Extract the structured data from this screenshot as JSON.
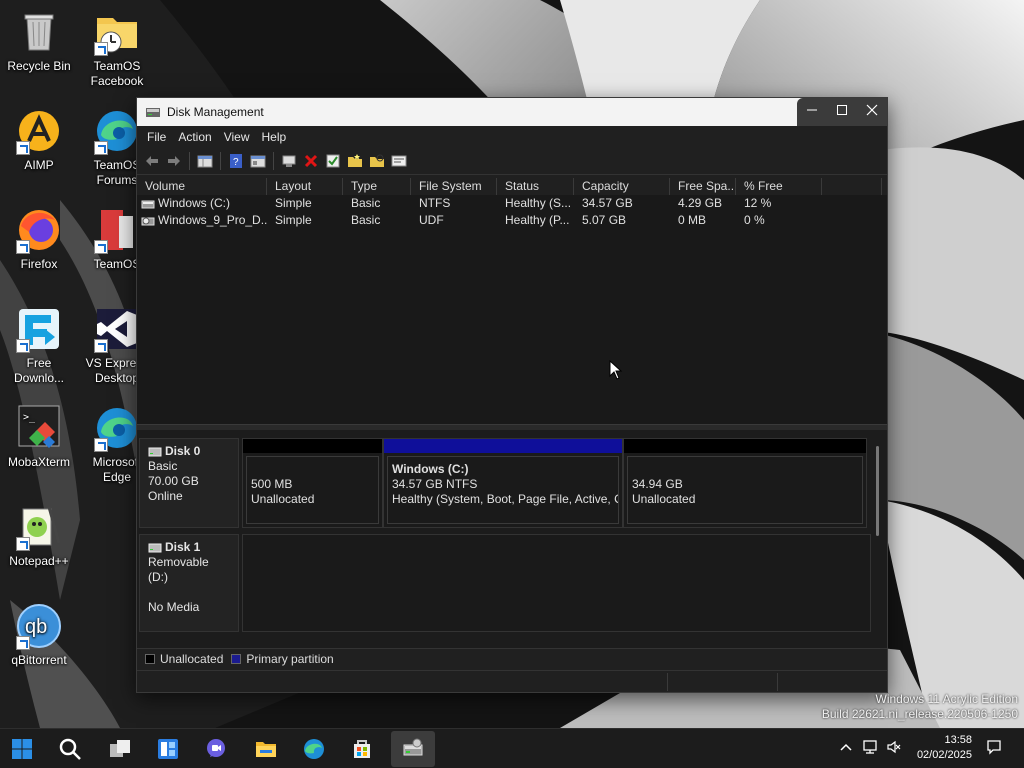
{
  "desktop": {
    "icons": [
      {
        "label": "Recycle Bin"
      },
      {
        "label": "TeamOS Facebook"
      },
      {
        "label": "AIMP"
      },
      {
        "label": "TeamOS Forums"
      },
      {
        "label": "Firefox"
      },
      {
        "label": "TeamOS"
      },
      {
        "label": "Free Downlo..."
      },
      {
        "label": "VS Express Desktop"
      },
      {
        "label": "MobaXterm"
      },
      {
        "label": "Microsoft Edge"
      },
      {
        "label": "Notepad++"
      },
      {
        "label": "qBittorrent"
      }
    ]
  },
  "window": {
    "title": "Disk Management",
    "menu": [
      "File",
      "Action",
      "View",
      "Help"
    ],
    "toolbar_icons": [
      "back-icon",
      "forward-icon",
      "console-tree-icon",
      "help-icon",
      "properties-icon",
      "connect-icon",
      "delete-icon",
      "check-icon",
      "new-folder-icon",
      "folder-search-icon",
      "settings-list-icon"
    ]
  },
  "volume_list": {
    "columns": [
      "Volume",
      "Layout",
      "Type",
      "File System",
      "Status",
      "Capacity",
      "Free Spa...",
      "% Free",
      ""
    ],
    "rows": [
      [
        "Windows (C:)",
        "Simple",
        "Basic",
        "NTFS",
        "Healthy (S...",
        "34.57 GB",
        "4.29 GB",
        "12 %"
      ],
      [
        "Windows_9_Pro_D...",
        "Simple",
        "Basic",
        "UDF",
        "Healthy (P...",
        "5.07 GB",
        "0 MB",
        "0 %"
      ]
    ]
  },
  "disks": [
    {
      "name": "Disk 0",
      "type": "Basic",
      "size": "70.00 GB",
      "state": "Online",
      "partitions": [
        {
          "title": "",
          "line1": "500 MB",
          "line2": "Unallocated",
          "kind": "unallocated"
        },
        {
          "title": "Windows  (C:)",
          "line1": "34.57 GB NTFS",
          "line2": "Healthy (System, Boot, Page File, Active, C",
          "kind": "primary"
        },
        {
          "title": "",
          "line1": "34.94 GB",
          "line2": "Unallocated",
          "kind": "unallocated"
        }
      ]
    },
    {
      "name": "Disk 1",
      "type": "Removable (D:)",
      "size": "",
      "state": "No Media"
    }
  ],
  "legend": [
    {
      "label": "Unallocated",
      "color": "#000000"
    },
    {
      "label": "Primary partition",
      "color": "#1b1b8f"
    }
  ],
  "watermark": {
    "line1": "Windows 11 Acrylic Edition",
    "line2": "Build 22621.ni_release.220506-1250"
  },
  "clock": {
    "time": "13:58",
    "date": "02/02/2025"
  },
  "colors": {
    "primary_partition": "#0f0f9a",
    "unallocated": "#000000"
  }
}
